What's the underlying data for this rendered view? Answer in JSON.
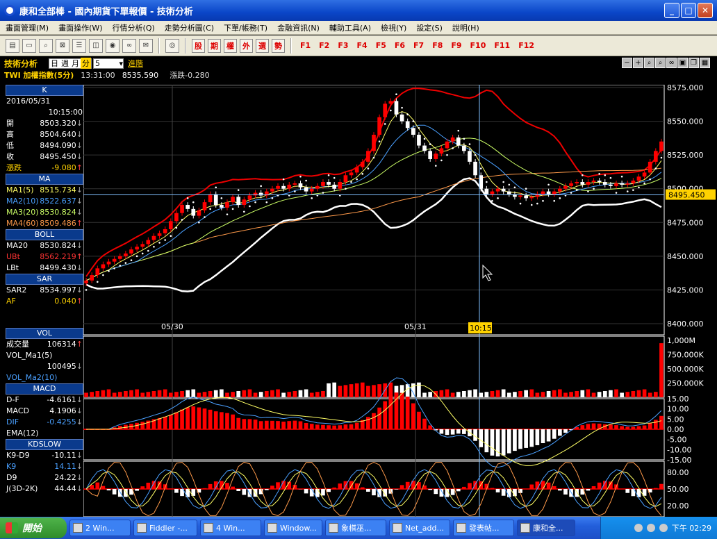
{
  "window": {
    "title": "康和全部棒 - 國內期貨下單報價 - 技術分析"
  },
  "menu": [
    "畫面管理(M)",
    "畫面操作(W)",
    "行情分析(Q)",
    "走勢分析圖(C)",
    "下單/帳務(T)",
    "金融資訊(N)",
    "輔助工具(A)",
    "檢視(Y)",
    "設定(S)",
    "說明(H)"
  ],
  "toolbar": {
    "quick": [
      "股",
      "期",
      "權",
      "外",
      "選",
      "勢"
    ],
    "fkeys": [
      "F1",
      "F2",
      "F3",
      "F4",
      "F5",
      "F6",
      "F7",
      "F8",
      "F9",
      "F10",
      "F11",
      "F12"
    ]
  },
  "tech": {
    "title": "技術分析",
    "periods": [
      "日",
      "週",
      "月",
      "分"
    ],
    "selected_period": "分",
    "interval": "5",
    "advanced": "進階"
  },
  "quote": {
    "symbol": "TWI  加權指數(5分)",
    "time": "13:31:00",
    "price": "8535.590",
    "change": "漲跌-0.280"
  },
  "left": {
    "k": {
      "header": "K",
      "date": "2016/05/31",
      "time": "10:15:00",
      "rows": [
        {
          "label": "開",
          "value": "8503.320"
        },
        {
          "label": "高",
          "value": "8504.640"
        },
        {
          "label": "低",
          "value": "8494.090"
        },
        {
          "label": "收",
          "value": "8495.450"
        },
        {
          "label": "漲跌",
          "value": "-9.080"
        }
      ]
    },
    "ma": {
      "header": "MA",
      "rows": [
        {
          "label": "MA1(5)",
          "value": "8515.734"
        },
        {
          "label": "MA2(10)",
          "value": "8522.637"
        },
        {
          "label": "MA3(20)",
          "value": "8530.824"
        },
        {
          "label": "MA4(60)",
          "value": "8509.486"
        }
      ]
    },
    "boll": {
      "header": "BOLL",
      "rows": [
        {
          "label": "MA20",
          "value": "8530.824"
        },
        {
          "label": "UBt",
          "value": "8562.219"
        },
        {
          "label": "LBt",
          "value": "8499.430"
        }
      ]
    },
    "sar": {
      "header": "SAR",
      "rows": [
        {
          "label": "SAR2",
          "value": "8534.997"
        },
        {
          "label": "AF",
          "value": "0.040"
        }
      ]
    },
    "vol": {
      "header": "VOL",
      "rows": [
        {
          "label": "成交量",
          "value": "106314"
        },
        {
          "label": "VOL_Ma1(5)",
          "value": ""
        },
        {
          "label": "",
          "value": "100495"
        },
        {
          "label": "VOL_Ma2(10)",
          "value": ""
        }
      ]
    },
    "macd": {
      "header": "MACD",
      "rows": [
        {
          "label": "D-F",
          "value": "-4.6161"
        },
        {
          "label": "MACD",
          "value": "4.1906"
        },
        {
          "label": "DIF",
          "value": "-0.4255"
        },
        {
          "label": "EMA(12)",
          "value": ""
        }
      ]
    },
    "kd": {
      "header": "KDSLOW",
      "rows": [
        {
          "label": "K9-D9",
          "value": "-10.11"
        },
        {
          "label": "K9",
          "value": "14.11"
        },
        {
          "label": "D9",
          "value": "24.22"
        },
        {
          "label": "J(3D-2K)",
          "value": "44.44"
        }
      ]
    }
  },
  "chart_data": [
    {
      "type": "candlestick",
      "title": "K",
      "x_labels": [
        "05/30",
        "05/31"
      ],
      "cursor_time": "10:15",
      "current_price_label": "8495.450",
      "ylim": [
        8400,
        8575
      ],
      "y_ticks": [
        "8575.000",
        "8550.000",
        "8525.000",
        "8500.000",
        "8475.000",
        "8450.000",
        "8425.000",
        "8400.000"
      ],
      "close": [
        8432,
        8436,
        8441,
        8444,
        8446,
        8448,
        8450,
        8452,
        8455,
        8457,
        8459,
        8462,
        8465,
        8467,
        8470,
        8476,
        8482,
        8488,
        8485,
        8480,
        8484,
        8490,
        8496,
        8488,
        8486,
        8490,
        8494,
        8488,
        8492,
        8495,
        8497,
        8495,
        8498,
        8500,
        8502,
        8500,
        8503,
        8504,
        8501,
        8498,
        8500,
        8502,
        8505,
        8503,
        8500,
        8505,
        8510,
        8512,
        8516,
        8520,
        8528,
        8540,
        8553,
        8563,
        8565,
        8555,
        8550,
        8545,
        8540,
        8532,
        8528,
        8522,
        8526,
        8530,
        8535,
        8538,
        8532,
        8528,
        8520,
        8510,
        8500,
        8496,
        8498,
        8500,
        8498,
        8496,
        8494,
        8495,
        8493,
        8494,
        8496,
        8498,
        8496,
        8498,
        8500,
        8502,
        8504,
        8505,
        8503,
        8505,
        8506,
        8505,
        8503,
        8502,
        8504,
        8503,
        8504,
        8506,
        8509,
        8512,
        8520,
        8528,
        8535
      ],
      "ma_lines": [
        "MA1(5)",
        "MA2(10)",
        "MA3(20)",
        "MA4(60)"
      ],
      "bands": [
        "UBt",
        "LBt"
      ]
    },
    {
      "type": "bar",
      "title": "VOL",
      "y_ticks": [
        "1,000M",
        "750.000K",
        "500.000K",
        "250.000K"
      ],
      "ylim": [
        0,
        1000000
      ]
    },
    {
      "type": "line",
      "title": "MACD",
      "y_ticks": [
        "15.00",
        "10.00",
        "5.00",
        "0.00",
        "-5.00",
        "-10.00",
        "-15.00"
      ],
      "ylim": [
        -15,
        15
      ]
    },
    {
      "type": "line",
      "title": "KDSLOW",
      "y_ticks": [
        "80.00",
        "50.00",
        "20.00"
      ],
      "ylim": [
        0,
        100
      ]
    }
  ],
  "colors": {
    "up": "#ff0000",
    "down": "#ffffff",
    "grid": "#404040",
    "cursor": "#80c0ff",
    "accent": "#ffd200"
  },
  "taskbar": {
    "start": "開始",
    "tasks": [
      "2 Win...",
      "Fiddler -...",
      "4 Win...",
      "Window...",
      "象棋巫...",
      "Net_add...",
      "發表帖...",
      "康和全..."
    ],
    "clock": "下午 02:29"
  }
}
